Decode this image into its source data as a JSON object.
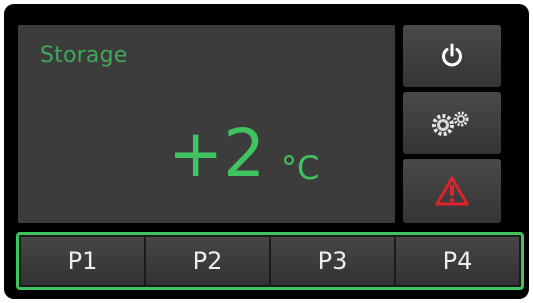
{
  "display": {
    "mode_label": "Storage",
    "temperature": "+2",
    "unit": "°C"
  },
  "side_buttons": [
    {
      "icon": "power-icon"
    },
    {
      "icon": "gears-icon"
    },
    {
      "icon": "warning-icon"
    }
  ],
  "programs": [
    {
      "label": "P1"
    },
    {
      "label": "P2"
    },
    {
      "label": "P3"
    },
    {
      "label": "P4"
    }
  ],
  "colors": {
    "accent_green": "#3fc45f",
    "warning_red": "#e0232b",
    "panel_gray": "#3c3c3c"
  }
}
